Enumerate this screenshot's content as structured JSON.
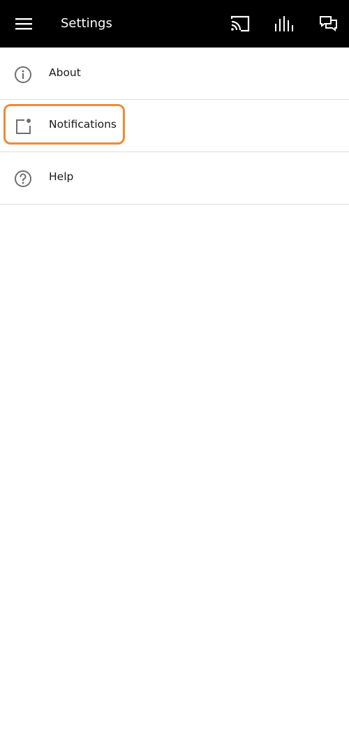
{
  "header": {
    "title": "Settings",
    "menu_icon": "hamburger-menu-icon",
    "actions": [
      {
        "icon": "cast-icon"
      },
      {
        "icon": "sound-bars-icon"
      },
      {
        "icon": "chat-bubbles-icon"
      }
    ],
    "background": "#000000",
    "text_color": "#ffffff"
  },
  "settings": {
    "items": [
      {
        "label": "About",
        "icon": "info-icon"
      },
      {
        "label": "Notifications",
        "icon": "notification-dot-icon",
        "highlighted": true
      },
      {
        "label": "Help",
        "icon": "help-icon"
      }
    ]
  },
  "colors": {
    "highlight": "#f08a35",
    "icon": "#6e6e6e",
    "divider": "#dcdcdc"
  }
}
